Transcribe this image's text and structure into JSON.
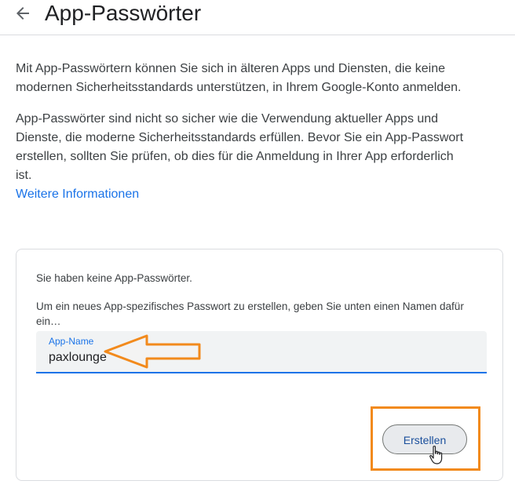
{
  "header": {
    "title": "App-Passwörter",
    "back_icon": "arrow-left-icon"
  },
  "intro": {
    "paragraph1": "Mit App-Passwörtern können Sie sich in älteren Apps und Diensten, die keine modernen Sicherheitsstandards unterstützen, in Ihrem Google-Konto anmelden.",
    "paragraph2": "App-Passwörter sind nicht so sicher wie die Verwendung aktueller Apps und Dienste, die moderne Sicherheitsstandards erfüllen. Bevor Sie ein App-Passwort erstellen, sollten Sie prüfen, ob dies für die Anmeldung in Ihrer App erforderlich ist.",
    "learn_more": "Weitere Informationen"
  },
  "card": {
    "no_passwords": "Sie haben keine App-Passwörter.",
    "instruction": "Um ein neues App-spezifisches Passwort zu erstellen, geben Sie unten einen Namen dafür ein…",
    "field_label": "App-Name",
    "field_value": "paxlounge",
    "create_label": "Erstellen"
  },
  "colors": {
    "accent": "#1a73e8",
    "annotation": "#f28a1c"
  }
}
